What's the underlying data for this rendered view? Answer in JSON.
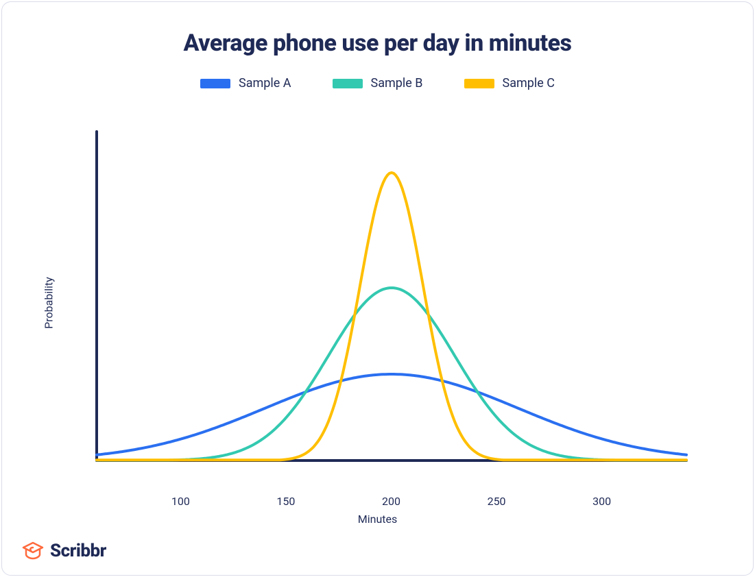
{
  "title": "Average phone use per day in minutes",
  "legend": {
    "a": "Sample A",
    "b": "Sample B",
    "c": "Sample C"
  },
  "colors": {
    "a": "#2a6ff0",
    "b": "#33c9b0",
    "c": "#ffbf00",
    "axis": "#1f2a56"
  },
  "axes": {
    "ylabel": "Probability",
    "xlabel": "Minutes",
    "ticks": [
      "100",
      "150",
      "200",
      "250",
      "300"
    ]
  },
  "logo": "Scribbr",
  "chart_data": {
    "type": "line",
    "title": "Average phone use per day in minutes",
    "xlabel": "Minutes",
    "ylabel": "Probability",
    "x_range": [
      60,
      340
    ],
    "x_ticks": [
      100,
      150,
      200,
      250,
      300
    ],
    "note": "Three normal probability density curves with common mean 200 and different spreads. Y-axis shows relative probability (unscaled).",
    "series": [
      {
        "name": "Sample A",
        "color": "#2a6ff0",
        "mean": 200,
        "sd": 60,
        "peak_rel": 0.3
      },
      {
        "name": "Sample B",
        "color": "#33c9b0",
        "mean": 200,
        "sd": 30,
        "peak_rel": 0.6
      },
      {
        "name": "Sample C",
        "color": "#ffbf00",
        "mean": 200,
        "sd": 15,
        "peak_rel": 1.0
      }
    ]
  }
}
